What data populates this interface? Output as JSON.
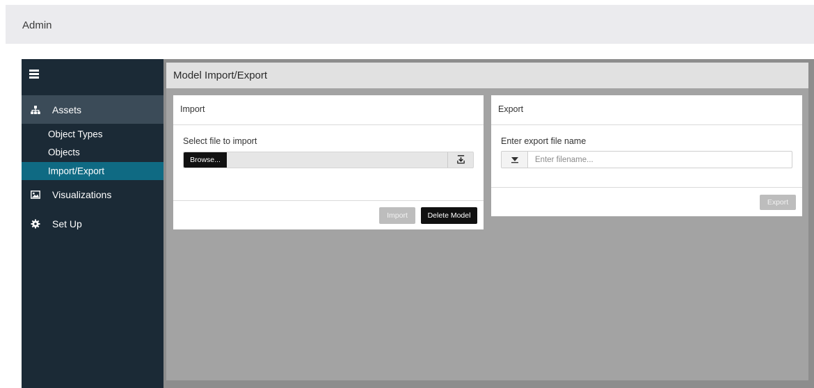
{
  "app": {
    "title": "Admin"
  },
  "sidebar": {
    "items": [
      {
        "label": "Assets",
        "icon": "sitemap-icon"
      },
      {
        "label": "Visualizations",
        "icon": "image-icon"
      },
      {
        "label": "Set Up",
        "icon": "gear-icon"
      }
    ],
    "sub_items": [
      {
        "label": "Object Types"
      },
      {
        "label": "Objects"
      },
      {
        "label": "Import/Export"
      }
    ],
    "active_sub_item": "Import/Export"
  },
  "main": {
    "title": "Model Import/Export",
    "import_panel": {
      "title": "Import",
      "field_label": "Select file to import",
      "browse_label": "Browse...",
      "file_value": "",
      "import_label": "Import",
      "delete_label": "Delete Model"
    },
    "export_panel": {
      "title": "Export",
      "field_label": "Enter export file name",
      "input_placeholder": "Enter filename...",
      "input_value": "",
      "export_label": "Export"
    }
  },
  "colors": {
    "sidebar_bg": "#1b2a36",
    "active_nav_bg": "#3b4b58",
    "active_sub_bg": "#0f6a83",
    "content_bg": "#a3a3a3",
    "dark_button": "#111111",
    "disabled_button": "#bdbdbd"
  }
}
